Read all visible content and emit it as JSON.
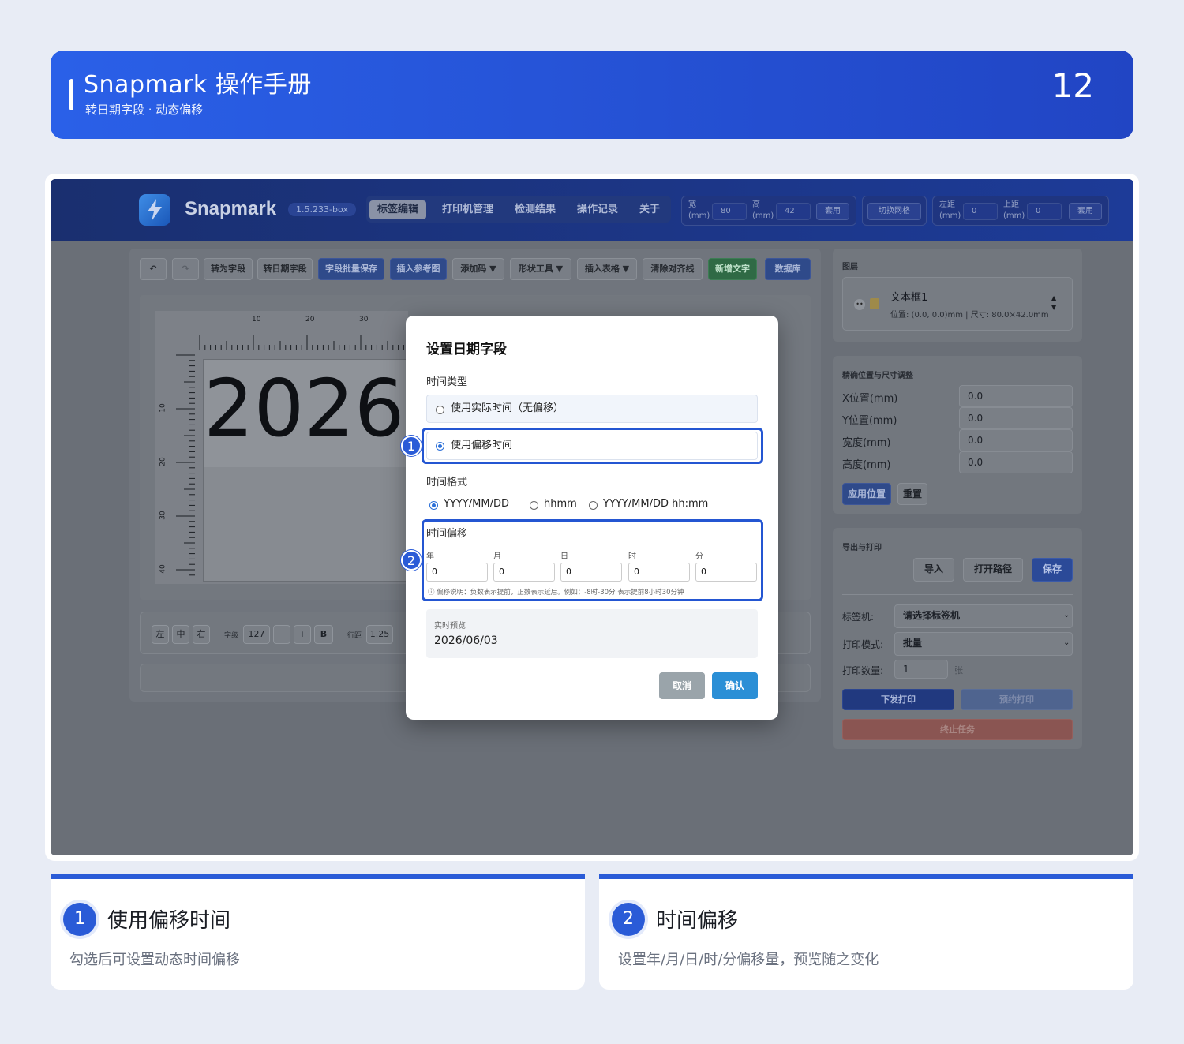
{
  "header": {
    "title": "Snapmark 操作手册",
    "subtitle": "转日期字段 · 动态偏移",
    "page_number": "12"
  },
  "app": {
    "brand": "Snapmark",
    "version": "1.5.233-box",
    "nav": [
      "标签编辑",
      "打印机管理",
      "检测结果",
      "操作记录",
      "关于"
    ],
    "active_nav": "标签编辑",
    "size": {
      "w_label": "宽",
      "h_label": "高",
      "unit": "(mm)",
      "w": "80",
      "h": "42",
      "apply": "套用"
    },
    "grid_toggle": "切换网格",
    "margin": {
      "left_label": "左距",
      "top_label": "上距",
      "unit": "(mm)",
      "left": "0",
      "top": "0",
      "apply": "套用"
    }
  },
  "toolbar": {
    "undo": "↶",
    "redo": "↷",
    "to_field": "转为字段",
    "to_date_field": "转日期字段",
    "batch_save": "字段批量保存",
    "insert_ref": "插入参考图",
    "add_code": "添加码 ▼",
    "shape_tools": "形状工具 ▼",
    "insert_table": "插入表格 ▼",
    "clear_guides": "清除对齐线",
    "add_text": "新增文字",
    "database": "数据库"
  },
  "canvas": {
    "ruler_top": [
      "10",
      "20",
      "30"
    ],
    "ruler_left": [
      "10",
      "20",
      "30",
      "40"
    ],
    "label_text": "2026/"
  },
  "format_bar": {
    "left": "左",
    "center": "中",
    "right": "右",
    "size_label": "字级",
    "size": "127",
    "minus": "−",
    "plus": "+",
    "bold": "B",
    "line_label": "行距",
    "line": "1.25"
  },
  "layers": {
    "title": "图层",
    "item_name": "文本框1",
    "item_meta": "位置: (0.0, 0.0)mm | 尺寸: 80.0×42.0mm"
  },
  "position": {
    "title": "精确位置与尺寸调整",
    "fields": [
      {
        "label": "X位置(mm)",
        "value": "0.0"
      },
      {
        "label": "Y位置(mm)",
        "value": "0.0"
      },
      {
        "label": "宽度(mm)",
        "value": "0.0"
      },
      {
        "label": "高度(mm)",
        "value": "0.0"
      }
    ],
    "apply": "应用位置",
    "reset": "重置"
  },
  "export": {
    "title": "导出与打印",
    "import": "导入",
    "open_path": "打开路径",
    "save": "保存",
    "printer_label": "标签机:",
    "printer_value": "请选择标签机",
    "mode_label": "打印模式:",
    "mode_value": "批量",
    "qty_label": "打印数量:",
    "qty_value": "1",
    "qty_unit": "张",
    "send": "下发打印",
    "schedule": "预约打印",
    "stop": "终止任务"
  },
  "dialog": {
    "title": "设置日期字段",
    "type_label": "时间类型",
    "opt_actual": "使用实际时间（无偏移）",
    "opt_offset": "使用偏移时间",
    "format_label": "时间格式",
    "formats": [
      "YYYY/MM/DD",
      "hhmm",
      "YYYY/MM/DD hh:mm"
    ],
    "offset_label": "时间偏移",
    "offset_fields": [
      {
        "label": "年",
        "value": "0"
      },
      {
        "label": "月",
        "value": "0"
      },
      {
        "label": "日",
        "value": "0"
      },
      {
        "label": "时",
        "value": "0"
      },
      {
        "label": "分",
        "value": "0"
      }
    ],
    "offset_note": "ⓘ 偏移说明：负数表示提前，正数表示延后。例如：-8时-30分 表示提前8小时30分钟",
    "preview_label": "实时预览",
    "preview_value": "2026/06/03",
    "cancel": "取消",
    "confirm": "确认"
  },
  "callouts": [
    {
      "num": "1",
      "title": "使用偏移时间",
      "desc": "勾选后可设置动态时间偏移"
    },
    {
      "num": "2",
      "title": "时间偏移",
      "desc": "设置年/月/日/时/分偏移量，预览随之变化"
    }
  ],
  "colors": {
    "accent": "#2a5bd7",
    "confirm": "#2b8fd6",
    "cancel": "#9aa4aa",
    "stop": "#c0605a"
  }
}
